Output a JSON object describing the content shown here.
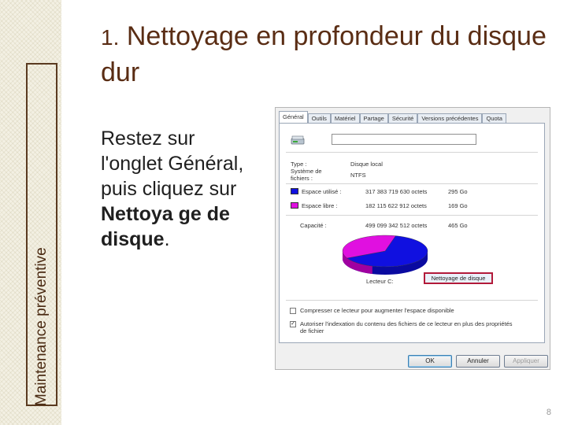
{
  "sidebar_label": "Maintenance préventive",
  "slide": {
    "title_number": "1.",
    "title_text": "Nettoyage en profondeur du disque dur",
    "body_part1": "Restez sur l'onglet Général, puis cliquez sur ",
    "body_bold": "Nettoya ge de disque",
    "body_end": ".",
    "page_number": "8"
  },
  "dialog": {
    "tabs": [
      "Général",
      "Outils",
      "Matériel",
      "Partage",
      "Sécurité",
      "Versions précédentes",
      "Quota"
    ],
    "active_tab": "Général",
    "name_value": "",
    "type_label": "Type :",
    "type_value": "Disque local",
    "fs_label": "Système de fichiers :",
    "fs_value": "NTFS",
    "used_label": "Espace utilisé :",
    "used_bytes": "317 383 719 630 octets",
    "used_size": "295 Go",
    "free_label": "Espace libre :",
    "free_bytes": "182 115 622 912 octets",
    "free_size": "169 Go",
    "capacity_label": "Capacité :",
    "capacity_bytes": "499 099 342 512 octets",
    "capacity_size": "465 Go",
    "drive_label": "Lecteur C:",
    "cleanup_button": "Nettoyage de disque",
    "compress_label": "Compresser ce lecteur pour augmenter l'espace disponible",
    "index_label": "Autoriser l'indexation du contenu des fichiers de ce lecteur en plus des propriétés de fichier",
    "compress_checked": false,
    "index_checked": true,
    "ok_button": "OK",
    "cancel_button": "Annuler",
    "apply_button": "Appliquer",
    "colors": {
      "used": "#1010e0",
      "free": "#e010e0",
      "cleanup_highlight": "#b21a3a"
    },
    "used_fraction": 0.636
  }
}
